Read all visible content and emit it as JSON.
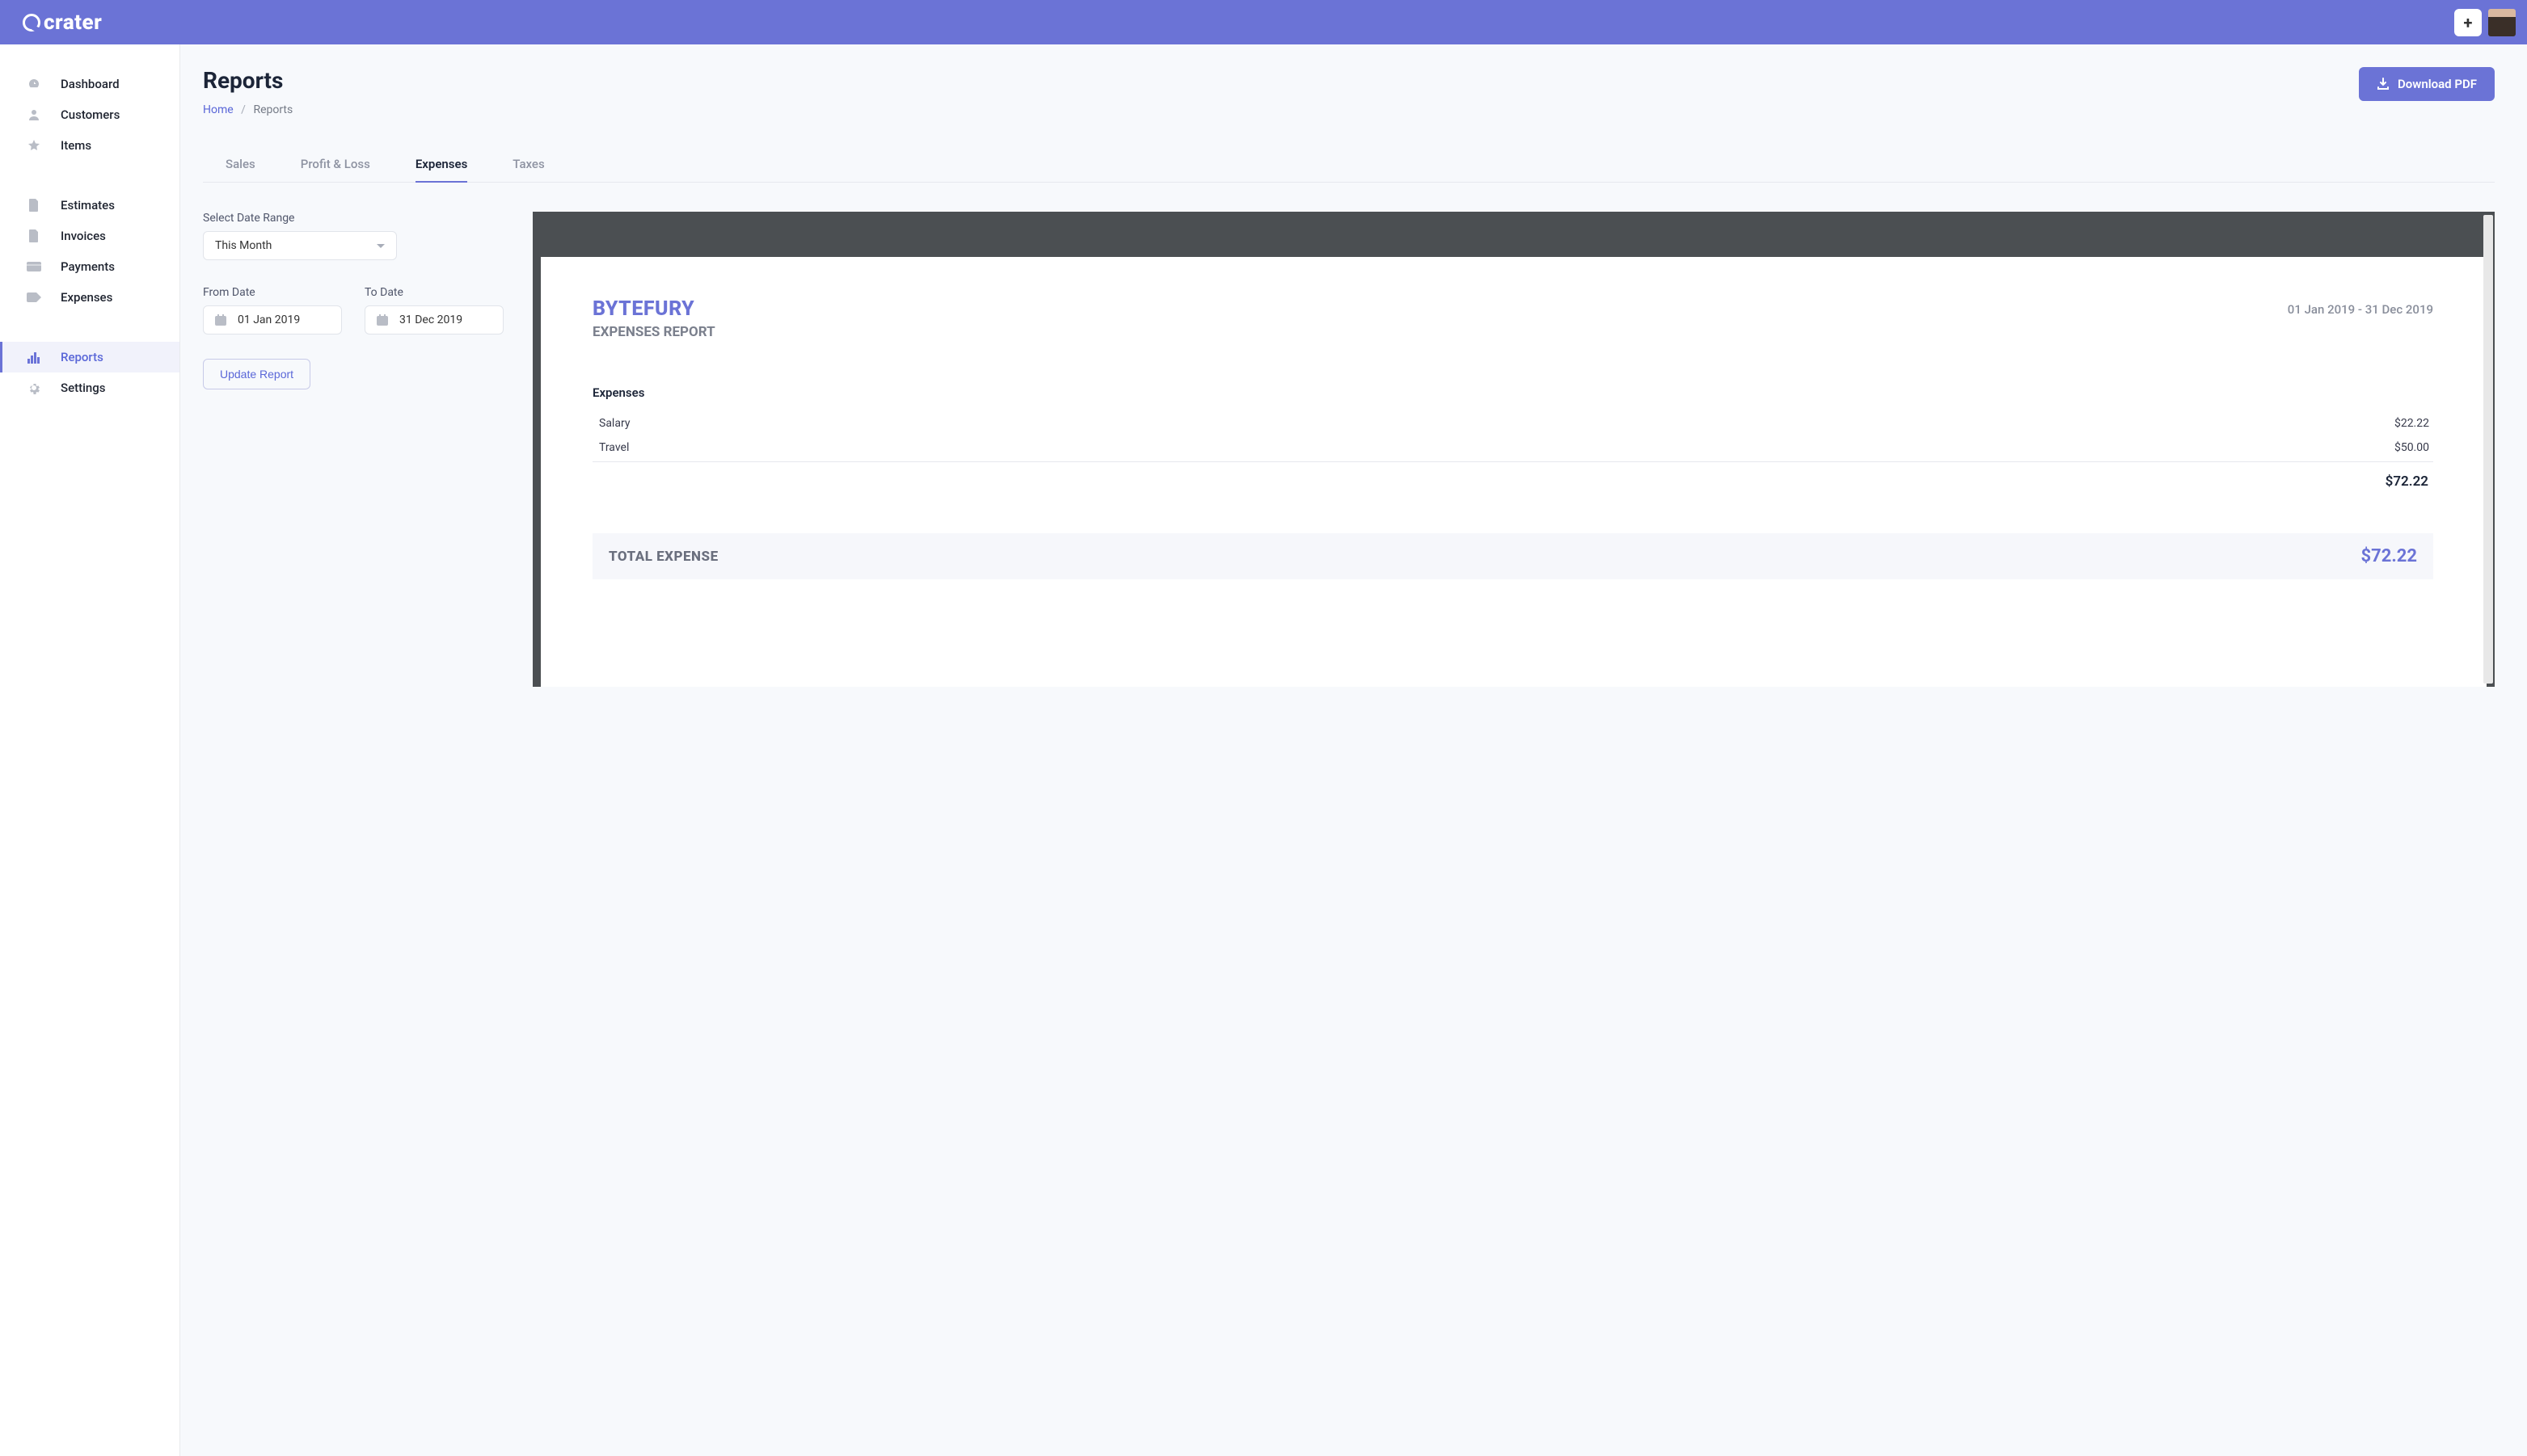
{
  "brand": "crater",
  "header": {
    "title": "Reports",
    "breadcrumb_home": "Home",
    "breadcrumb_current": "Reports",
    "download_label": "Download PDF"
  },
  "sidebar": {
    "group1": [
      {
        "label": "Dashboard",
        "icon": "gauge"
      },
      {
        "label": "Customers",
        "icon": "user"
      },
      {
        "label": "Items",
        "icon": "star"
      }
    ],
    "group2": [
      {
        "label": "Estimates",
        "icon": "file"
      },
      {
        "label": "Invoices",
        "icon": "file-lines"
      },
      {
        "label": "Payments",
        "icon": "credit-card"
      },
      {
        "label": "Expenses",
        "icon": "tag"
      }
    ],
    "group3": [
      {
        "label": "Reports",
        "icon": "bar-chart",
        "active": true
      },
      {
        "label": "Settings",
        "icon": "gear"
      }
    ]
  },
  "tabs": [
    {
      "label": "Sales"
    },
    {
      "label": "Profit & Loss"
    },
    {
      "label": "Expenses",
      "active": true
    },
    {
      "label": "Taxes"
    }
  ],
  "filters": {
    "range_label": "Select Date Range",
    "range_value": "This Month",
    "from_label": "From Date",
    "from_value": "01 Jan 2019",
    "to_label": "To Date",
    "to_value": "31 Dec 2019",
    "update_label": "Update Report"
  },
  "report": {
    "company": "BYTEFURY",
    "subtitle": "EXPENSES REPORT",
    "date_range": "01 Jan 2019 - 31 Dec 2019",
    "section": "Expenses",
    "rows": [
      {
        "name": "Salary",
        "amount": "$22.22"
      },
      {
        "name": "Travel",
        "amount": "$50.00"
      }
    ],
    "subtotal": "$72.22",
    "total_label": "TOTAL EXPENSE",
    "total_amount": "$72.22"
  }
}
